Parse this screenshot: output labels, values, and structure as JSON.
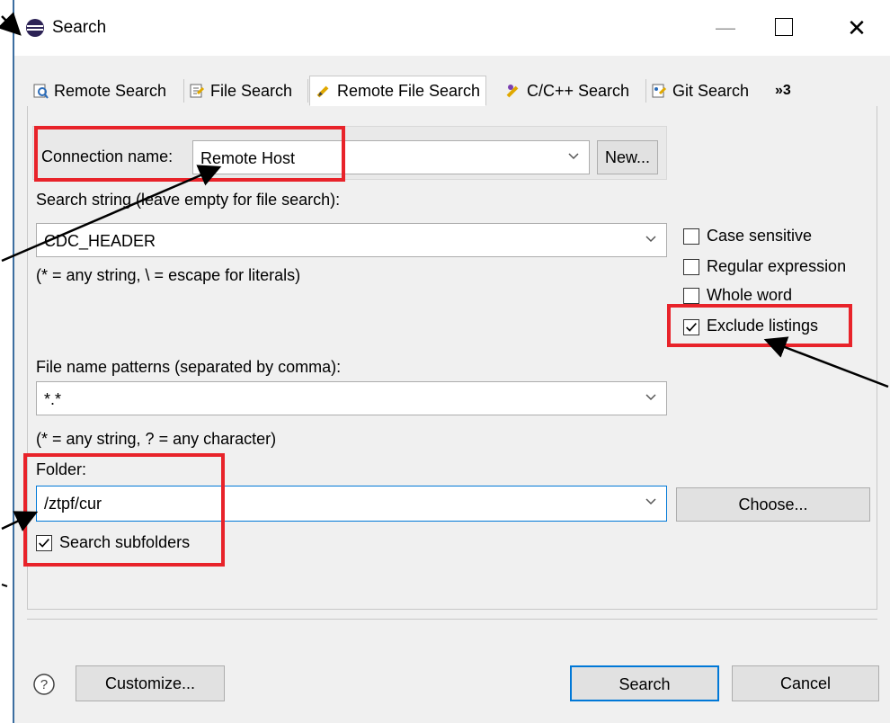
{
  "window": {
    "title": "Search"
  },
  "tabs": [
    {
      "label": "Remote Search",
      "icon": "remote-search-icon"
    },
    {
      "label": "File Search",
      "icon": "file-search-icon"
    },
    {
      "label": "Remote File Search",
      "icon": "remote-file-search-icon",
      "active": true
    },
    {
      "label": "C/C++ Search",
      "icon": "cpp-search-icon"
    },
    {
      "label": "Git Search",
      "icon": "git-search-icon"
    },
    {
      "label": "»3",
      "icon": "overflow-icon"
    }
  ],
  "connection": {
    "label": "Connection name:",
    "value": "Remote Host",
    "new_label": "New..."
  },
  "search_string": {
    "label": "Search string (leave empty for file search):",
    "value": "CDC_HEADER",
    "hint": "(* = any string, \\ = escape for literals)"
  },
  "options": [
    {
      "label": "Case sensitive",
      "checked": false
    },
    {
      "label": "Regular expression",
      "checked": false
    },
    {
      "label": "Whole word",
      "checked": false
    },
    {
      "label": "Exclude listings",
      "checked": true
    }
  ],
  "file_patterns": {
    "label": "File name patterns (separated by comma):",
    "value": "*.*",
    "hint": "(* = any string, ? = any character)"
  },
  "folder": {
    "label": "Folder:",
    "value": "/ztpf/cur",
    "choose_label": "Choose...",
    "subfolders_label": "Search subfolders",
    "subfolders_checked": true
  },
  "footer": {
    "customize_label": "Customize...",
    "search_label": "Search",
    "cancel_label": "Cancel",
    "help_icon": "help-icon"
  },
  "colors": {
    "highlight": "#e8232a",
    "primary_border": "#0078d7"
  }
}
